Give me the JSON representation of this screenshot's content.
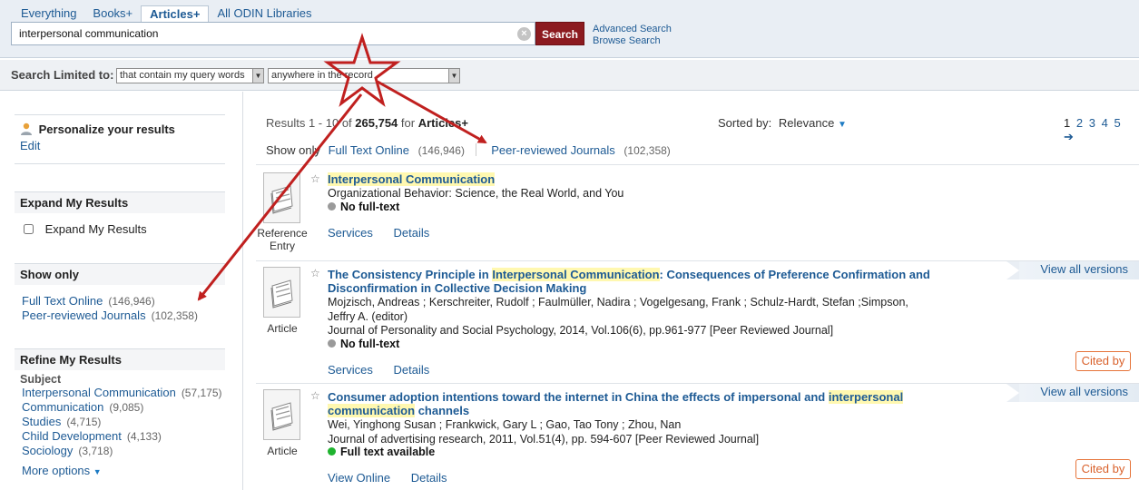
{
  "tabs": [
    {
      "label": "Everything"
    },
    {
      "label": "Books+"
    },
    {
      "label": "Articles+"
    },
    {
      "label": "All ODIN Libraries"
    }
  ],
  "search": {
    "value": "interpersonal communication",
    "button_label": "Search",
    "clear_icon": "x-icon",
    "advanced_label": "Advanced Search",
    "browse_label": "Browse Search"
  },
  "limit": {
    "label": "Search Limited to:",
    "select1": "that contain my query words",
    "select2": "anywhere in the record"
  },
  "sidebar": {
    "personalize": {
      "title": "Personalize your results",
      "edit": "Edit"
    },
    "expand": {
      "heading": "Expand My Results",
      "checkbox_label": "Expand My Results"
    },
    "showonly": {
      "heading": "Show only",
      "items": [
        {
          "label": "Full Text Online",
          "count": "(146,946)"
        },
        {
          "label": "Peer-reviewed Journals",
          "count": "(102,358)"
        }
      ]
    },
    "refine": {
      "heading": "Refine My Results",
      "subject_label": "Subject",
      "items": [
        {
          "label": "Interpersonal Communication",
          "count": "(57,175)"
        },
        {
          "label": "Communication",
          "count": "(9,085)"
        },
        {
          "label": "Studies",
          "count": "(4,715)"
        },
        {
          "label": "Child Development",
          "count": "(4,133)"
        },
        {
          "label": "Sociology",
          "count": "(3,718)"
        }
      ],
      "more_options": "More options"
    }
  },
  "results_header": {
    "prefix": "Results 1 - 10 of",
    "total": "265,754",
    "for_label": "for",
    "scope": "Articles+",
    "sorted_label": "Sorted by:",
    "sort_value": "Relevance",
    "pages": [
      "1",
      "2",
      "3",
      "4",
      "5"
    ],
    "show_only_label": "Show only",
    "filters": [
      {
        "label": "Full Text Online",
        "count": "(146,946)"
      },
      {
        "label": "Peer-reviewed Journals",
        "count": "(102,358)"
      }
    ]
  },
  "results": [
    {
      "type": "Reference Entry",
      "title_parts": [
        "Interpersonal Communication"
      ],
      "source": "Organizational Behavior: Science, the Real World, and You",
      "availability": "No full-text",
      "actions": [
        "Services",
        "Details"
      ]
    },
    {
      "type": "Article",
      "title_line1_a": "The Consistency Principle in ",
      "title_line1_hl": "Interpersonal Communication",
      "title_line1_b": ": Consequences of Preference Confirmation and",
      "title_line2": "Disconfirmation in Collective Decision Making",
      "authors_line1": "Mojzisch, Andreas ; Kerschreiter, Rudolf ; Faulmüller, Nadira ; Vogelgesang, Frank ; Schulz-Hardt, Stefan ;Simpson,",
      "authors_line2": "Jeffry A. (editor)",
      "source": "Journal of Personality and Social Psychology, 2014, Vol.106(6), pp.961-977 [Peer Reviewed Journal]",
      "availability": "No full-text",
      "actions": [
        "Services",
        "Details"
      ],
      "versions": "View all versions",
      "cited": "Cited by"
    },
    {
      "type": "Article",
      "title_line1_a": "Consumer adoption intentions toward the internet in China the effects of impersonal and ",
      "title_line1_hl": "interpersonal",
      "title_line2_hl": "communication",
      "title_line2_b": " channels",
      "authors_line1": "Wei, Yinghong Susan ; Frankwick, Gary L ; Gao, Tao Tony ; Zhou, Nan",
      "source": "Journal of advertising research, 2011, Vol.51(4), pp. 594-607 [Peer Reviewed Journal]",
      "availability": "Full text available",
      "actions": [
        "View Online",
        "Details"
      ],
      "versions": "View all versions",
      "cited": "Cited by"
    }
  ],
  "colors": {
    "link": "#1d5a94",
    "search_button": "#8c1a1f",
    "annotation": "#c0201f",
    "cited_border": "#e6743a",
    "available_dot": "#1fb32f",
    "unavailable_dot": "#9a9a9a"
  }
}
